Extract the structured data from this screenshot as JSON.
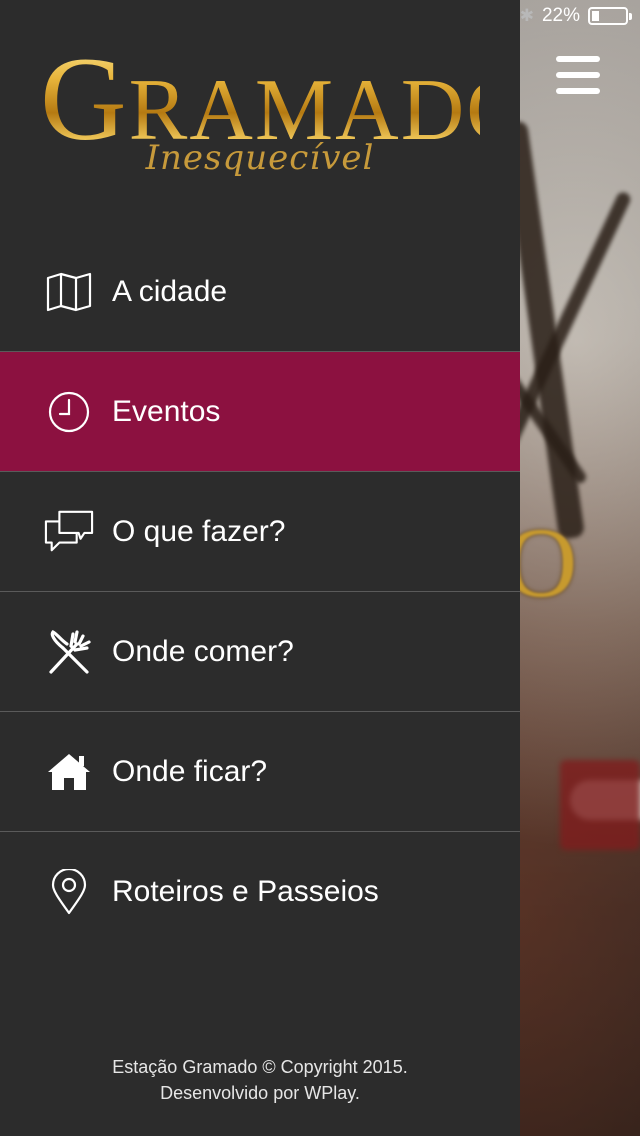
{
  "status": {
    "battery_text": "22%",
    "battery_level": 0.22
  },
  "logo": {
    "title_initial": "G",
    "title_rest": "RAMADO",
    "subtitle": "Inesquecível"
  },
  "menu": {
    "items": [
      {
        "label": "A cidade",
        "icon": "map-icon",
        "active": false
      },
      {
        "label": "Eventos",
        "icon": "clock-icon",
        "active": true
      },
      {
        "label": "O que fazer?",
        "icon": "chat-bubbles-icon",
        "active": false
      },
      {
        "label": "Onde comer?",
        "icon": "fork-knife-icon",
        "active": false
      },
      {
        "label": "Onde ficar?",
        "icon": "home-icon",
        "active": false
      },
      {
        "label": "Roteiros e Passeios",
        "icon": "map-pin-icon",
        "active": false
      }
    ]
  },
  "footer": {
    "line1": "Estação Gramado © Copyright 2015.",
    "line2": "Desenvolvido por WPlay."
  },
  "colors": {
    "drawer_bg": "#2c2c2c",
    "active_bg": "#8c1140",
    "divider": "#5a5a5a",
    "logo_gold": "#d9a42f"
  }
}
